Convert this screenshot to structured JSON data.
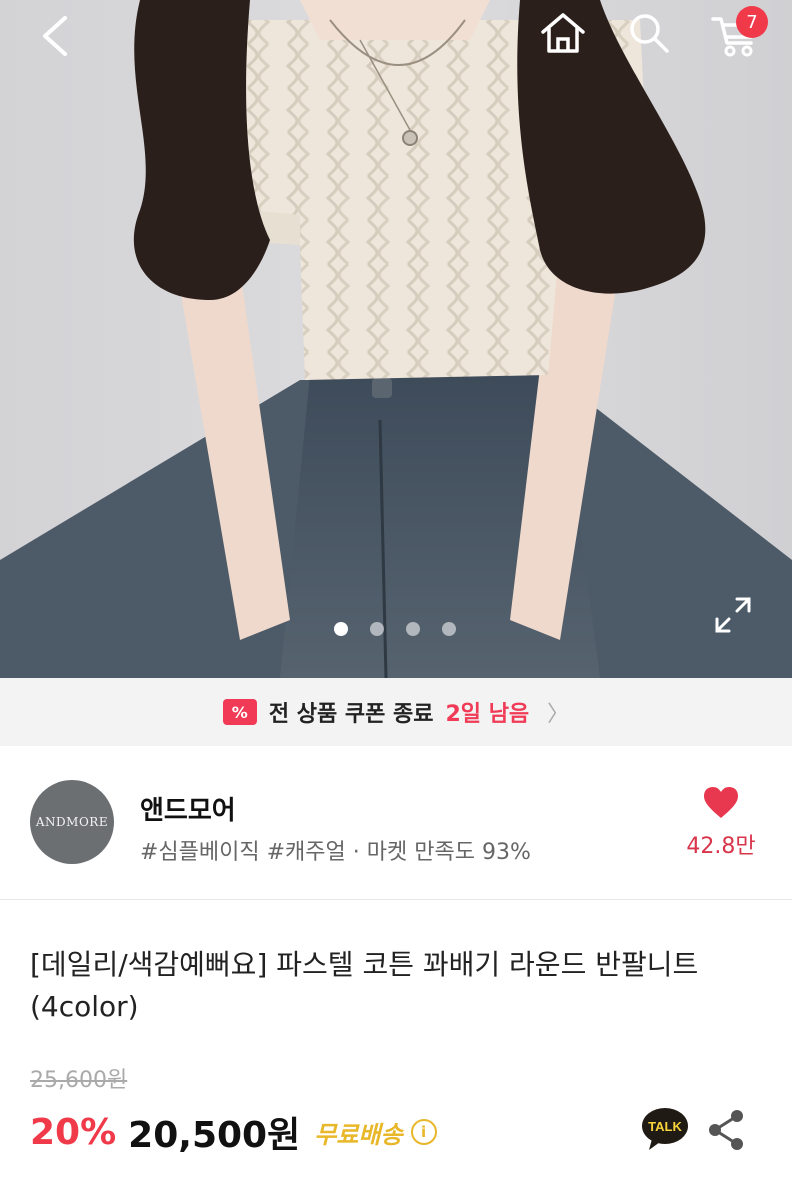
{
  "header": {
    "cart_count": "7",
    "icons": [
      "back-arrow-icon",
      "home-icon",
      "search-icon",
      "cart-icon",
      "expand-icon"
    ]
  },
  "gallery": {
    "total_images": 4,
    "active_index": 0
  },
  "coupon_banner": {
    "icon_symbol": "%",
    "text": "전 상품 쿠폰 종료",
    "remaining": "2일 남음",
    "chevron": "〉"
  },
  "seller": {
    "logo_text": "ANDMORE",
    "name": "앤드모어",
    "tags": "#심플베이직 #캐주얼 · 마켓 만족도 93%",
    "likes": "42.8만"
  },
  "product": {
    "title": "[데일리/색감예뻐요] 파스텔 코튼 꽈배기 라운드 반팔니트 (4color)",
    "original_price": "25,600원",
    "discount": "20%",
    "price": "20,500원",
    "shipping": "무료배송",
    "info_symbol": "i",
    "talk_label": "TALK"
  },
  "colors": {
    "accent": "#f03a4a",
    "shipping": "#e8b72a",
    "like": "#e8384f",
    "badge": "#f03a4a"
  }
}
